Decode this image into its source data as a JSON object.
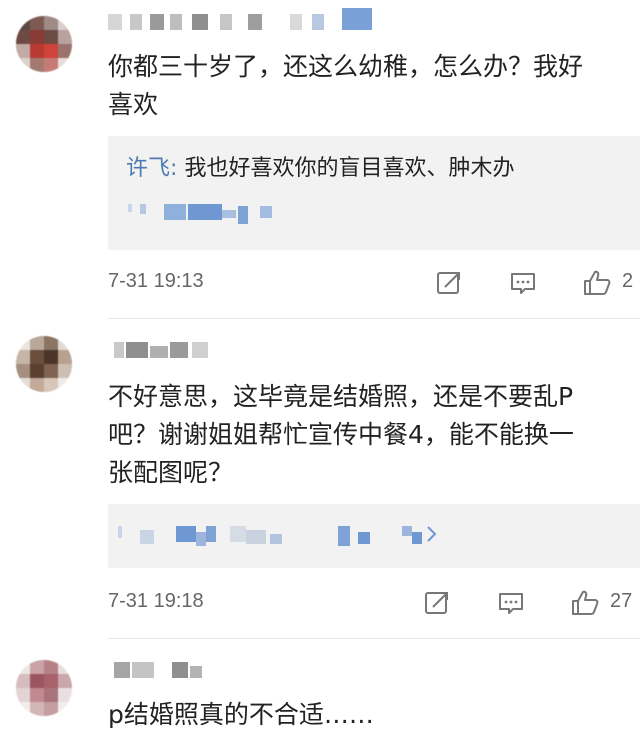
{
  "comments": [
    {
      "text_lines": [
        "你都三十岁了，还这么幼稚，怎么办？我好",
        "喜欢"
      ],
      "reply": {
        "name": "许飞",
        "separator": ":",
        "content": "我也好喜欢你的盲目喜欢、肿木办"
      },
      "timestamp": "7-31 19:13",
      "like_count": "2"
    },
    {
      "text_lines": [
        "不好意思，这毕竟是结婚照，还是不要乱P",
        "吧？谢谢姐姐帮忙宣传中餐4，能不能换一",
        "张配图呢？"
      ],
      "timestamp": "7-31 19:18",
      "like_count": "27"
    },
    {
      "text_lines": [
        "p结婚照真的不合适……"
      ]
    }
  ],
  "icons": {
    "share": "share-icon",
    "comment": "comment-icon",
    "like": "thumbs-up-icon",
    "more": "chevron-right-icon"
  },
  "colors": {
    "reply_name": "#4e7bb3",
    "reply_bg": "#f2f2f2",
    "meta_text": "#666666"
  }
}
